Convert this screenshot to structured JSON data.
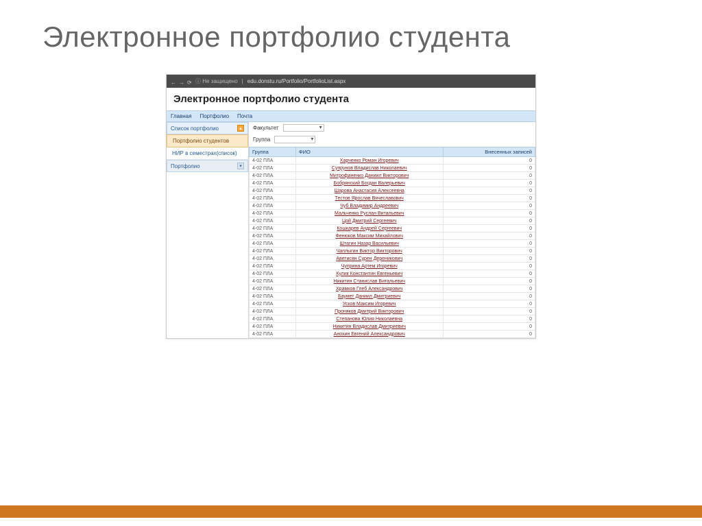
{
  "slide_title": "Электронное портфолио студента",
  "browser": {
    "security": "Не защищено",
    "url": "edu.donstu.ru/Portfolio/PortfolioList.aspx"
  },
  "page_heading": "Электронное портфолио студента",
  "menu": [
    "Главная",
    "Портфолио",
    "Почта"
  ],
  "sidebar": {
    "section1_title": "Список портфолио",
    "items": [
      {
        "label": "Портфолио студентов",
        "active": true
      },
      {
        "label": "НИР в семестрах(список)",
        "active": false
      }
    ],
    "section2_title": "Портфолио"
  },
  "filters": {
    "faculty_label": "Факультет",
    "group_label": "Группа"
  },
  "table": {
    "columns": [
      "Группа",
      "ФИО",
      "Внесенных записей"
    ],
    "rows": [
      {
        "group": "4-02 ПЛА",
        "name": "Харченко Роман Игоревич",
        "count": 0
      },
      {
        "group": "4-02 ПЛА",
        "name": "Супрунов Владислав Николаевич",
        "count": 0
      },
      {
        "group": "4-02 ПЛА",
        "name": "Митрофаненко Даниил Викторович",
        "count": 0
      },
      {
        "group": "4-02 ПЛА",
        "name": "Бобрянский Богдан Валерьевич",
        "count": 0
      },
      {
        "group": "4-02 ПЛА",
        "name": "Шарова Анастасия Алексеевна",
        "count": 0
      },
      {
        "group": "4-02 ПЛА",
        "name": "Тестов Ярослав Вячеславович",
        "count": 0
      },
      {
        "group": "4-02 ПЛА",
        "name": "Чуб Владимир Андреевич",
        "count": 0
      },
      {
        "group": "4-02 ПЛА",
        "name": "Мальченко Руслан Витальевич",
        "count": 0
      },
      {
        "group": "4-02 ПЛА",
        "name": "Цой Дмитрий Сергеевич",
        "count": 0
      },
      {
        "group": "4-02 ПЛА",
        "name": "Кошкарев Андрей Сергеевич",
        "count": 0
      },
      {
        "group": "4-02 ПЛА",
        "name": "Фенюков Максим Михайлович",
        "count": 0
      },
      {
        "group": "4-02 ПЛА",
        "name": "Штагин Назар Васильевич",
        "count": 0
      },
      {
        "group": "4-02 ПЛА",
        "name": "Чаплыгин Виктор Викторович",
        "count": 0
      },
      {
        "group": "4-02 ПЛА",
        "name": "Аветисян Сурен Дереникович",
        "count": 0
      },
      {
        "group": "4-02 ПЛА",
        "name": "Чуприна Артем Игоревич",
        "count": 0
      },
      {
        "group": "4-02 ПЛА",
        "name": "Кулик Константин Евгеньевич",
        "count": 0
      },
      {
        "group": "4-02 ПЛА",
        "name": "Никитин Станислав Витальевич",
        "count": 0
      },
      {
        "group": "4-02 ПЛА",
        "name": "Храмков Глеб Александрович",
        "count": 0
      },
      {
        "group": "4-02 ПЛА",
        "name": "Баумет Даниил Дмитриевич",
        "count": 0
      },
      {
        "group": "4-02 ПЛА",
        "name": "Усков Максим Игоревич",
        "count": 0
      },
      {
        "group": "4-02 ПЛА",
        "name": "Проняков Дмитрий Викторович",
        "count": 0
      },
      {
        "group": "4-02 ПЛА",
        "name": "Степанова Юлия Николаевна",
        "count": 0
      },
      {
        "group": "4-02 ПЛА",
        "name": "Никитин Владислав Дмитриевич",
        "count": 0
      },
      {
        "group": "4-02 ПЛА",
        "name": "Анохин Евгений Александрович",
        "count": 0
      }
    ]
  }
}
